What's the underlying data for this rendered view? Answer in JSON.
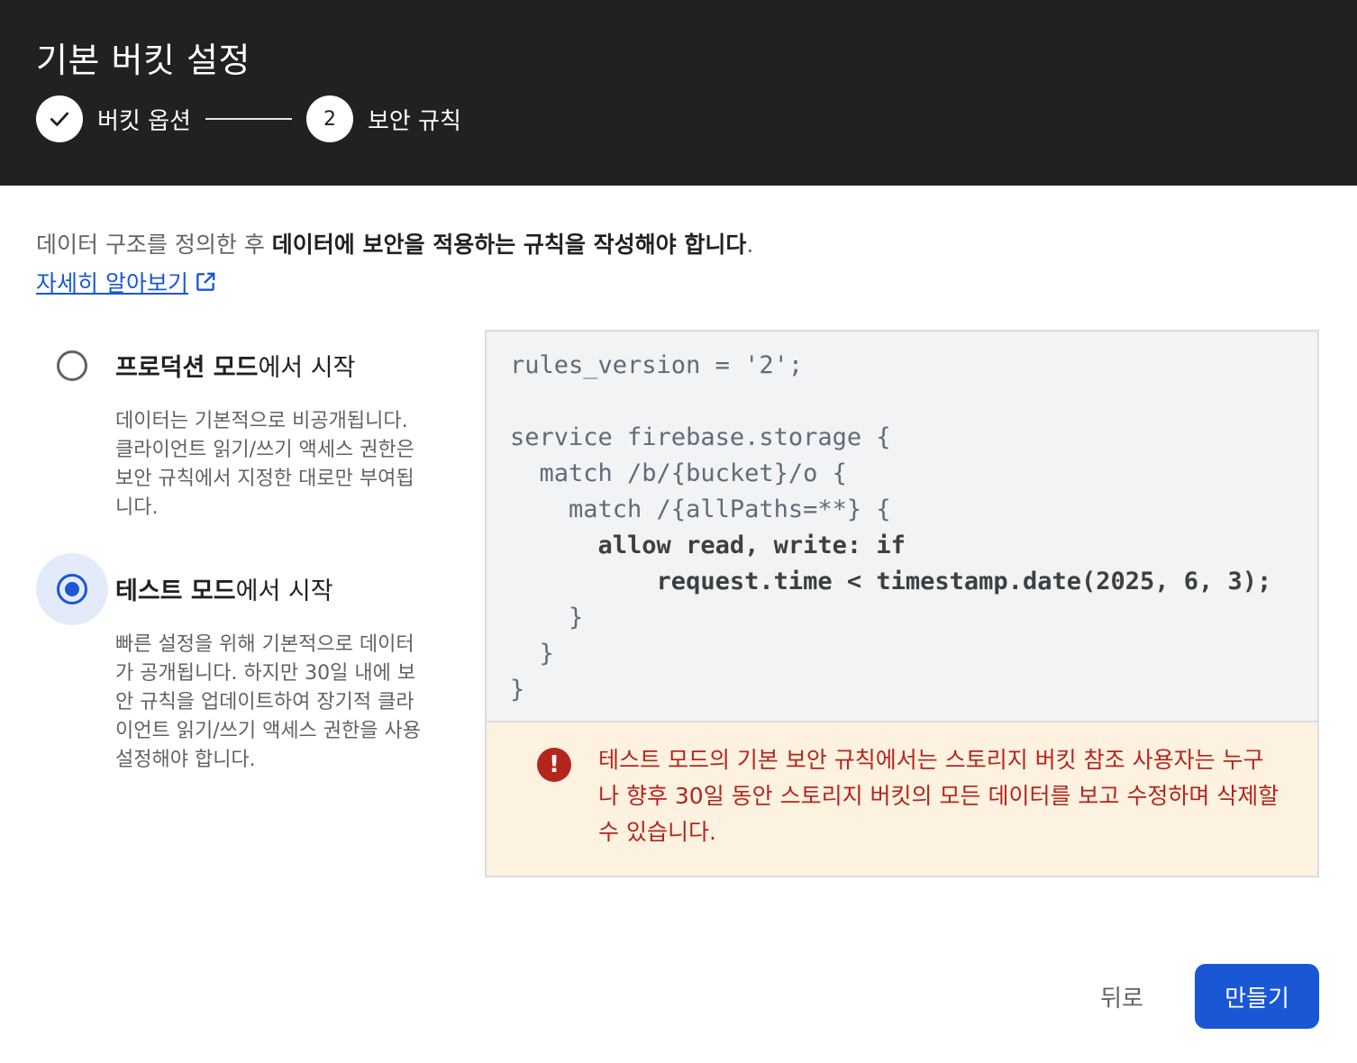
{
  "dialog": {
    "title": "기본 버킷 설정",
    "steps": [
      {
        "label": "버킷 옵션",
        "status": "completed",
        "icon": "check-icon"
      },
      {
        "label": "보안 규칙",
        "number": "2",
        "status": "active"
      }
    ]
  },
  "intro": {
    "text_plain": "데이터 구조를 정의한 후 ",
    "text_bold": "데이터에 보안을 적용하는 규칙을 작성해야 합니다",
    "text_end": ".",
    "learn_more": "자세히 알아보기",
    "learn_more_icon": "external-link-icon"
  },
  "options": [
    {
      "title_bold": "프로덕션 모드",
      "title_rest": "에서 시작",
      "description": "데이터는 기본적으로 비공개됩니다. 클라이언트 읽기/쓰기 액세스 권한은 보안 규칙에서 지정한 대로만 부여됩니다.",
      "selected": false
    },
    {
      "title_bold": "테스트 모드",
      "title_rest": "에서 시작",
      "description": "빠른 설정을 위해 기본적으로 데이터가 공개됩니다. 하지만 30일 내에 보안 규칙을 업데이트하여 장기적 클라이언트 읽기/쓰기 액세스 권한을 사용 설정해야 합니다.",
      "selected": true
    }
  ],
  "rules": {
    "lines": [
      "rules_version = '2';",
      "",
      "service firebase.storage {",
      "  match /b/{bucket}/o {",
      "    match /{allPaths=**} {",
      "      allow read, write: if",
      "          request.time < timestamp.date(2025, 6, 3);",
      "    }",
      "  }",
      "}"
    ]
  },
  "warning": {
    "icon": "error-icon",
    "text": "테스트 모드의 기본 보안 규칙에서는 스토리지 버킷 참조 사용자는 누구나 향후 30일 동안 스토리지 버킷의 모든 데이터를 보고 수정하며 삭제할 수 있습니다."
  },
  "actions": {
    "back_label": "뒤로",
    "create_label": "만들기"
  },
  "colors": {
    "header_bg": "#212121",
    "primary": "#1a57d4",
    "warning_text": "#b3261e",
    "warning_bg": "#fdf1e0"
  }
}
